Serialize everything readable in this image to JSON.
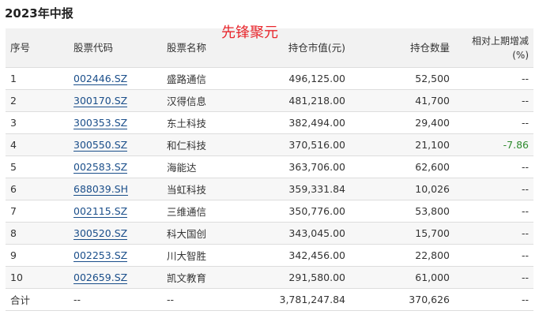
{
  "title": "2023年中报",
  "watermark": "先锋聚元",
  "headers": {
    "index": "序号",
    "code": "股票代码",
    "name": "股票名称",
    "value": "持仓市值(元)",
    "quantity": "持仓数量",
    "change_line1": "相对上期增减",
    "change_line2": "(%)"
  },
  "rows": [
    {
      "index": "1",
      "code": "002446.SZ",
      "name": "盛路通信",
      "value": "496,125.00",
      "quantity": "52,500",
      "change": "--"
    },
    {
      "index": "2",
      "code": "300170.SZ",
      "name": "汉得信息",
      "value": "481,218.00",
      "quantity": "41,700",
      "change": "--"
    },
    {
      "index": "3",
      "code": "300353.SZ",
      "name": "东土科技",
      "value": "382,494.00",
      "quantity": "29,400",
      "change": "--"
    },
    {
      "index": "4",
      "code": "300550.SZ",
      "name": "和仁科技",
      "value": "370,516.00",
      "quantity": "21,100",
      "change": "-7.86"
    },
    {
      "index": "5",
      "code": "002583.SZ",
      "name": "海能达",
      "value": "363,706.00",
      "quantity": "62,600",
      "change": "--"
    },
    {
      "index": "6",
      "code": "688039.SH",
      "name": "当虹科技",
      "value": "359,331.84",
      "quantity": "10,026",
      "change": "--"
    },
    {
      "index": "7",
      "code": "002115.SZ",
      "name": "三维通信",
      "value": "350,776.00",
      "quantity": "53,800",
      "change": "--"
    },
    {
      "index": "8",
      "code": "300520.SZ",
      "name": "科大国创",
      "value": "343,045.00",
      "quantity": "15,700",
      "change": "--"
    },
    {
      "index": "9",
      "code": "002253.SZ",
      "name": "川大智胜",
      "value": "342,456.00",
      "quantity": "22,800",
      "change": "--"
    },
    {
      "index": "10",
      "code": "002659.SZ",
      "name": "凯文教育",
      "value": "291,580.00",
      "quantity": "61,000",
      "change": "--"
    }
  ],
  "total": {
    "label": "合计",
    "code": "--",
    "name": "--",
    "value": "3,781,247.84",
    "quantity": "370,626",
    "change": "--"
  },
  "colors": {
    "negative": "#2e8b2e",
    "link": "#1a4e8a",
    "watermark": "#e8262c"
  }
}
